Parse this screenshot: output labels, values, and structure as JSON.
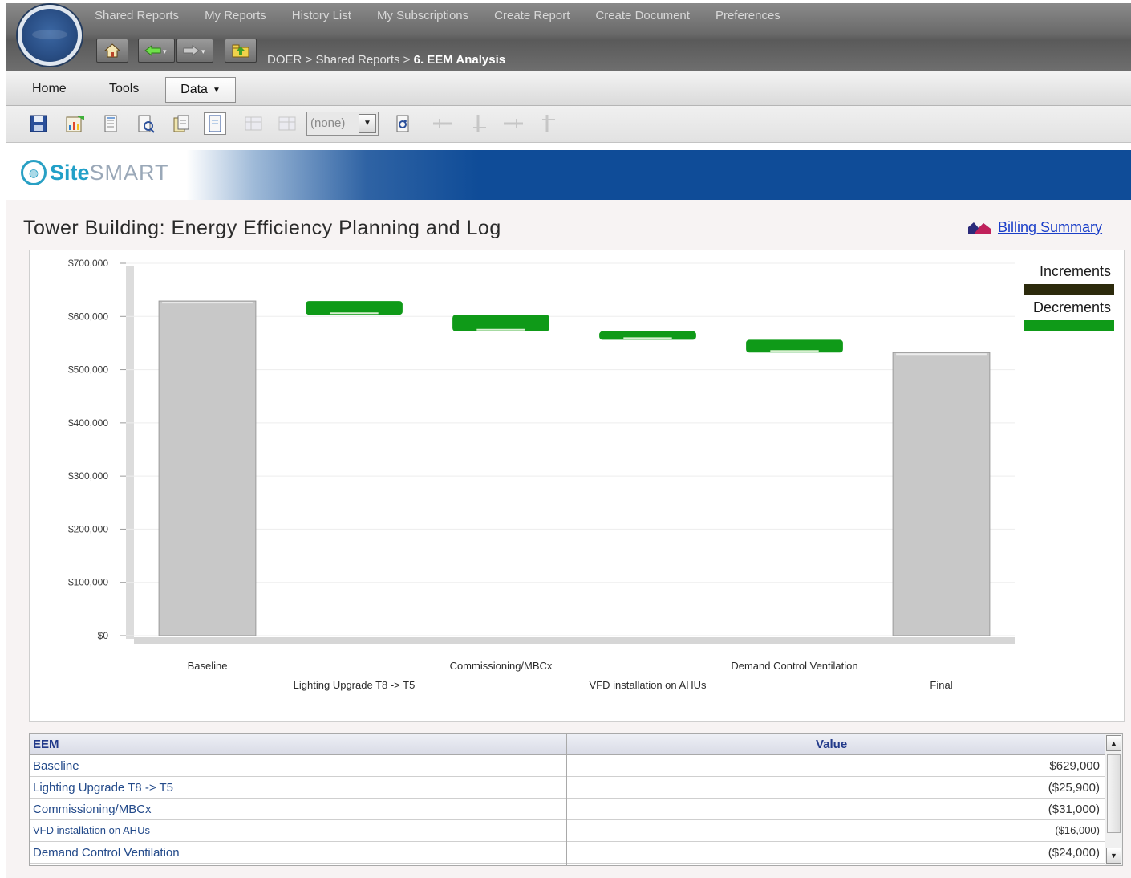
{
  "topnav": {
    "links": [
      "Shared Reports",
      "My Reports",
      "History List",
      "My Subscriptions",
      "Create Report",
      "Create Document",
      "Preferences"
    ]
  },
  "breadcrumb": {
    "root": "DOER",
    "sep1": " > ",
    "level2": "Shared Reports",
    "sep2": " > ",
    "current": "6. EEM Analysis"
  },
  "menubar": {
    "home": "Home",
    "tools": "Tools",
    "data": "Data"
  },
  "toolbar": {
    "select_value": "(none)"
  },
  "banner": {
    "site": "Site",
    "smart": "SMART"
  },
  "page": {
    "title": "Tower Building: Energy Efficiency Planning and Log",
    "billing_link": "Billing Summary"
  },
  "colors": {
    "bar_gray": "#c8c8c8",
    "decrement_green": "#0f9a18",
    "increment_dark": "#2c2a0c",
    "banner_blue": "#0f4c98",
    "link_blue": "#1a3ec8"
  },
  "chart_data": {
    "type": "bar",
    "subtype": "waterfall",
    "categories": [
      "Baseline",
      "Lighting Upgrade T8 -> T5",
      "Commissioning/MBCx",
      "VFD installation on AHUs",
      "Demand Control Ventilation",
      "Final"
    ],
    "values": [
      629000,
      -25900,
      -31000,
      -16000,
      -24000,
      532100
    ],
    "y_tick_labels": [
      "$0",
      "$100,000",
      "$200,000",
      "$300,000",
      "$400,000",
      "$500,000",
      "$600,000",
      "$700,000"
    ],
    "ylim": [
      0,
      700000
    ],
    "legend": [
      "Increments",
      "Decrements"
    ],
    "legend_position": "right",
    "grid": true
  },
  "table": {
    "headers": [
      "EEM",
      "Value"
    ],
    "rows": [
      {
        "eem": "Baseline",
        "value": "$629,000"
      },
      {
        "eem": "Lighting Upgrade T8 -> T5",
        "value": "($25,900)"
      },
      {
        "eem": "Commissioning/MBCx",
        "value": "($31,000)"
      },
      {
        "eem": "VFD installation on AHUs",
        "value": "($16,000)"
      },
      {
        "eem": "Demand Control Ventilation",
        "value": "($24,000)"
      }
    ]
  }
}
